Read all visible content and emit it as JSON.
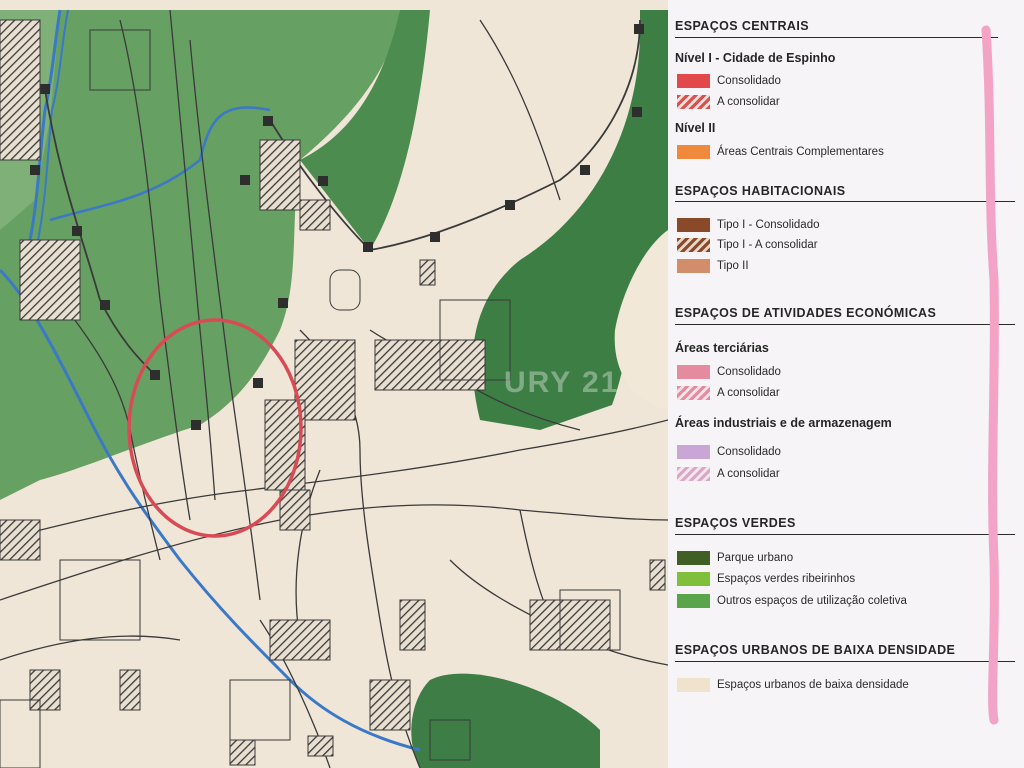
{
  "watermark": "URY 21",
  "colors": {
    "green_light": "#67a063",
    "green_dark": "#3d7e45",
    "beige": "#efe6d7",
    "water": "#3a78c8",
    "circle": "#d94a55",
    "line": "#3a3a3a"
  },
  "legend": {
    "centrais": {
      "title": "ESPAÇOS CENTRAIS",
      "nivel1": "Nível I - Cidade de Espinho",
      "consolidado": "Consolidado",
      "a_consolidar": "A consolidar",
      "nivel2": "Nível II",
      "complementares": "Áreas Centrais Complementares"
    },
    "habitacionais": {
      "title": "ESPAÇOS HABITACIONAIS",
      "tipo1_consolidado": "Tipo I - Consolidado",
      "tipo1_a_consolidar": "Tipo I - A consolidar",
      "tipo2": "Tipo II"
    },
    "atividades": {
      "title": "ESPAÇOS DE ATIVIDADES ECONÓMICAS",
      "terciarias": "Áreas terciárias",
      "terc_consolidado": "Consolidado",
      "terc_a_consolidar": "A consolidar",
      "industriais": "Áreas industriais e de armazenagem",
      "ind_consolidado": "Consolidado",
      "ind_a_consolidar": "A consolidar"
    },
    "verdes": {
      "title": "ESPAÇOS VERDES",
      "parque": "Parque urbano",
      "ribeirinhos": "Espaços verdes ribeirinhos",
      "outros": "Outros espaços de utilização coletiva"
    },
    "baixa": {
      "title": "ESPAÇOS URBANOS DE BAIXA DENSIDADE",
      "item": "Espaços urbanos de baixa densidade"
    }
  }
}
